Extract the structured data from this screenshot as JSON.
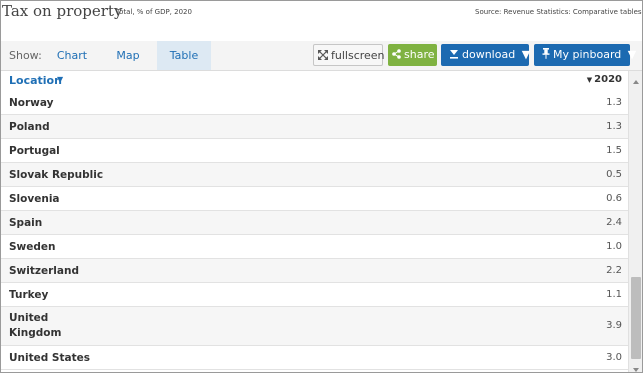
{
  "header": {
    "title": "Tax on property",
    "subtitle": "Total, % of GDP, 2020",
    "source": "Source: Revenue Statistics: Comparative tables"
  },
  "toolbar": {
    "show_label": "Show:",
    "tabs": [
      {
        "label": "Chart",
        "active": false
      },
      {
        "label": "Map",
        "active": false
      },
      {
        "label": "Table",
        "active": true
      }
    ],
    "fullscreen_label": "fullscreen",
    "share_label": "share",
    "download_label": "download",
    "pinboard_label": "My pinboard",
    "share_color": "#7fb241",
    "primary_color": "#1c6ab1"
  },
  "table": {
    "location_header": "Location",
    "year_header": "2020",
    "rows": [
      {
        "location": "Norway",
        "value": "1.3"
      },
      {
        "location": "Poland",
        "value": "1.3"
      },
      {
        "location": "Portugal",
        "value": "1.5"
      },
      {
        "location": "Slovak Republic",
        "value": "0.5"
      },
      {
        "location": "Slovenia",
        "value": "0.6"
      },
      {
        "location": "Spain",
        "value": "2.4"
      },
      {
        "location": "Sweden",
        "value": "1.0"
      },
      {
        "location": "Switzerland",
        "value": "2.2"
      },
      {
        "location": "Turkey",
        "value": "1.1"
      },
      {
        "location": "United Kingdom",
        "value": "3.9"
      },
      {
        "location": "United States",
        "value": "3.0"
      }
    ]
  },
  "icons": {
    "fullscreen": "expand-arrows-icon",
    "share": "share-icon",
    "download": "download-icon",
    "pinboard": "pin-icon"
  }
}
